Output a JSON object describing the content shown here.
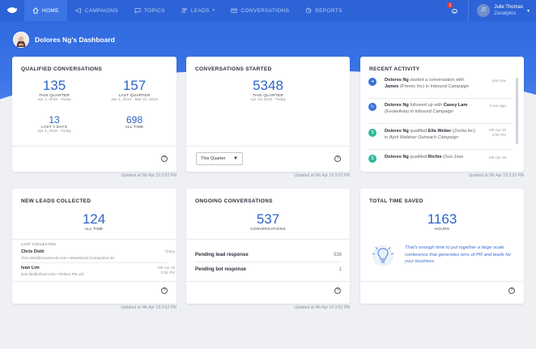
{
  "nav": {
    "items": [
      {
        "label": "HOME",
        "icon": "home-icon",
        "active": true
      },
      {
        "label": "CAMPAIGNS",
        "icon": "megaphone-icon",
        "active": false
      },
      {
        "label": "TOPICS",
        "icon": "chat-bubble-icon",
        "active": false
      },
      {
        "label": "LEADS",
        "icon": "users-icon",
        "active": false
      },
      {
        "label": "CONVERSATIONS",
        "icon": "envelope-icon",
        "active": false
      },
      {
        "label": "REPORTS",
        "icon": "chart-icon",
        "active": false
      }
    ]
  },
  "user": {
    "initials": "JT",
    "name": "Julie Thomas",
    "org": "Zenalytics",
    "notifications": "1"
  },
  "dashboard": {
    "title": "Dolores Ng's Dashboard"
  },
  "qualified": {
    "title": "QUALIFIED CONVERSATIONS",
    "m1": {
      "value": "135",
      "label": "THIS QUARTER",
      "range": "Apr 1, 2019 - Today"
    },
    "m2": {
      "value": "157",
      "label": "LAST QUARTER",
      "range": "Jan 1, 2019 - Mar 31, 2019"
    },
    "m3": {
      "value": "13",
      "label": "LAST 7 DAYS",
      "range": "Apr 4, 2019 - Today"
    },
    "m4": {
      "value": "698",
      "label": "ALL TIME",
      "range": ""
    },
    "updated": "Updated at 9th Apr 19 3:52 PM"
  },
  "started": {
    "title": "CONVERSATIONS STARTED",
    "value": "5348",
    "label": "THIS QUARTER",
    "range": "Apr 1st 2019 - Today",
    "select": "This Quarter",
    "updated": "Updated at 9th Apr 19 3:52 PM"
  },
  "activity": {
    "title": "RECENT ACTIVITY",
    "items": [
      {
        "who": "Dolores Ng",
        "text1": " started a conversation with ",
        "target": "James",
        "text2": " (Premic Inc) in ",
        "campaign": "Inbound Campaign",
        "time": "Just now",
        "icon_color": "#3a6fd8"
      },
      {
        "who": "Dolores Ng",
        "text1": " followed up with ",
        "target": "Casey Lam",
        "text2": " (EvokeAsia) in ",
        "campaign": "Inbound Campaign",
        "time": "5 min ago",
        "icon_color": "#3a6fd8"
      },
      {
        "who": "Dolores Ng",
        "text1": " qualified ",
        "target": "Ella Weber",
        "text2": " (Zoolia Inc) in ",
        "campaign": "April Webinar Outreach Campaign",
        "time": "9th Apr 19 3:52 PM",
        "icon_color": "#2fb89a"
      },
      {
        "who": "Dolores Ng",
        "text1": " qualified ",
        "target": "Richie",
        "text2": " (Sun Jose",
        "campaign": "",
        "time": "9th Apr 19",
        "icon_color": "#2fb89a"
      }
    ],
    "updated": "Updated at 9th Apr 19 3:52 PM"
  },
  "leads": {
    "title": "NEW LEADS COLLECTED",
    "value": "124",
    "label": "ALL TIME",
    "last_label": "LAST COLLECTED",
    "rows": [
      {
        "name": "Chris Dotti",
        "email": "chris.dotti@movescent.com",
        "company": "MoveScent Companies Inc",
        "date": "Today"
      },
      {
        "name": "Ivan Lim",
        "email": "ivan.lim@relium.com",
        "company": "Relium Pte Ltd",
        "date": "9th Apr 19 3:52 PM"
      }
    ],
    "updated": "Updated at 9th Apr 19 3:52 PM"
  },
  "ongoing": {
    "title": "ONGOING CONVERSATIONS",
    "value": "537",
    "label": "CONVERSATIONS",
    "rows": [
      {
        "label": "Pending lead response",
        "value": "536"
      },
      {
        "label": "Pending bot response",
        "value": "1"
      }
    ],
    "updated": "Updated at 9th Apr 19 3:52 PM"
  },
  "saved": {
    "title": "TOTAL TIME SAVED",
    "value": "1163",
    "label": "HOURS",
    "text": "That's enough time to put together a large scale conference that generates tens of PR and leads for your business."
  }
}
